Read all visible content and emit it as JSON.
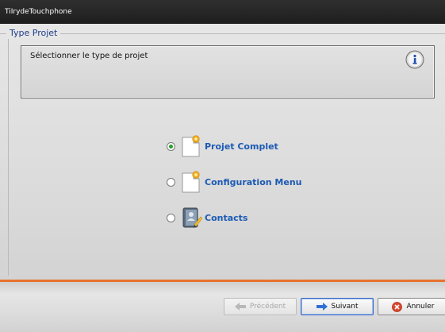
{
  "window": {
    "title": "TiIrydeTouchphone"
  },
  "group": {
    "label": "Type Projet"
  },
  "info": {
    "text": "Sélectionner le type de projet",
    "icon": "info-icon"
  },
  "options": [
    {
      "label": "Projet Complet",
      "selected": true,
      "icon": "document-icon"
    },
    {
      "label": "Configuration Menu",
      "selected": false,
      "icon": "document-icon"
    },
    {
      "label": "Contacts",
      "selected": false,
      "icon": "contacts-book-icon"
    }
  ],
  "buttons": {
    "previous": "Précédent",
    "next": "Suivant",
    "cancel": "Annuler"
  },
  "colors": {
    "accent": "#e8732e",
    "link_blue": "#1c5ab4",
    "group_label": "#1e3c8c",
    "radio_selected": "#2aa02a"
  }
}
